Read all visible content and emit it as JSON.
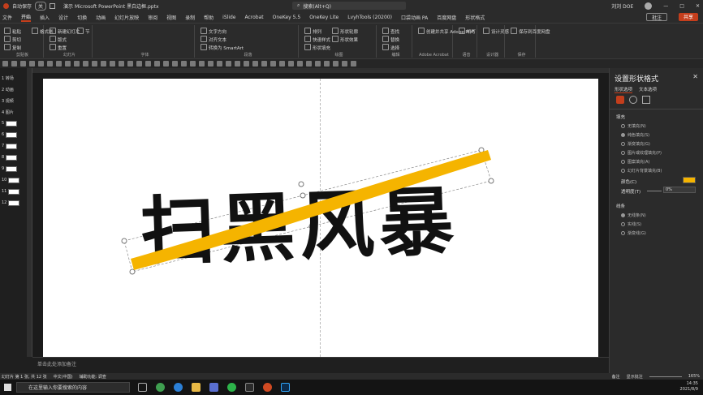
{
  "titlebar": {
    "autosave": "自动保存",
    "toggle": "关",
    "title": "演示 Microsoft PowerPoint 黑白边框.pptx",
    "search": "搜索(Alt+Q)",
    "user": "刘刘 DOE"
  },
  "tabs": [
    "文件",
    "开始",
    "插入",
    "设计",
    "切换",
    "动画",
    "幻灯片放映",
    "审阅",
    "视图",
    "录制",
    "帮助",
    "iSlide",
    "Acrobat",
    "OneKey 5.5",
    "OneKey Lite",
    "LvyhTools (20200)",
    "口袋动画 PA",
    "百度网盘",
    "形状格式"
  ],
  "active_tab": "开始",
  "buttons": {
    "comment": "批注",
    "share": "共享"
  },
  "ribbon": {
    "groups": [
      {
        "label": "剪贴板",
        "items": [
          "粘贴",
          "剪切",
          "复制",
          "格式刷"
        ]
      },
      {
        "label": "幻灯片",
        "items": [
          "新建幻灯片",
          "版式",
          "重置",
          "节"
        ]
      },
      {
        "label": "字体",
        "items": []
      },
      {
        "label": "段落",
        "items": [
          "文字方向",
          "对齐文本",
          "转换为 SmartArt"
        ]
      },
      {
        "label": "绘图",
        "items": [
          "排列",
          "快速样式",
          "形状填充",
          "形状轮廓",
          "形状效果"
        ]
      },
      {
        "label": "编辑",
        "items": [
          "查找",
          "替换",
          "选择"
        ]
      },
      {
        "label": "Adobe Acrobat",
        "items": [
          "创建并共享 Adobe PDF"
        ]
      },
      {
        "label": "语音",
        "items": [
          "听写"
        ]
      },
      {
        "label": "设计器",
        "items": [
          "设计灵感"
        ]
      },
      {
        "label": "保存",
        "items": [
          "保存到百度网盘"
        ]
      }
    ]
  },
  "thumbnails": [
    "1 转场",
    "2 动画",
    "3 视频",
    "4 图片",
    "5",
    "6",
    "7",
    "8",
    "9",
    "10",
    "11",
    "12"
  ],
  "slide": {
    "title_text": "扫黑风暴"
  },
  "notes": {
    "placeholder": "单击此处添加备注"
  },
  "pane": {
    "title": "设置形状格式",
    "subtabs": [
      "形状选项",
      "文本选项"
    ],
    "fill_section": "填充",
    "fill_options": [
      "无填充(N)",
      "纯色填充(S)",
      "渐变填充(G)",
      "图片或纹理填充(P)",
      "图案填充(A)",
      "幻灯片背景填充(B)"
    ],
    "color_label": "颜色(C)",
    "transparency_label": "透明度(T)",
    "transparency_value": "0%",
    "line_section": "线条",
    "line_options": [
      "无线条(N)",
      "实线(S)",
      "渐变线(G)"
    ]
  },
  "status": {
    "left": "幻灯片 第 1 张, 共 12 张",
    "lang": "中文(中国)",
    "access": "辅助功能: 调查",
    "notes": "备注",
    "comments": "显示批注",
    "zoom": "165%"
  },
  "taskbar": {
    "search": "在这里输入你要搜索的内容",
    "time": "14:35",
    "date": "2021/8/9"
  },
  "colors": {
    "accent": "#c43e1c",
    "brush": "#f5b400"
  }
}
